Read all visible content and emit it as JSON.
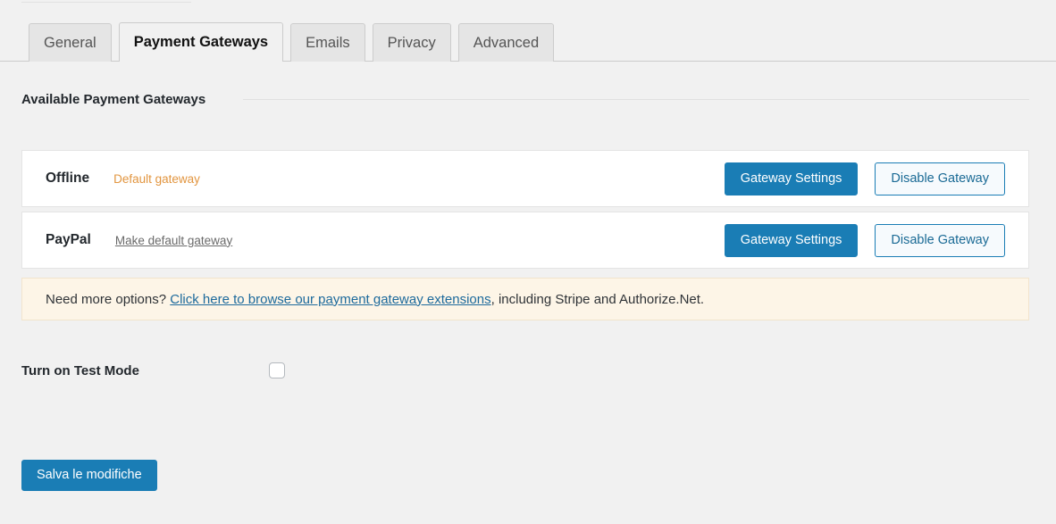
{
  "tabs": [
    {
      "label": "General",
      "active": false
    },
    {
      "label": "Payment Gateways",
      "active": true
    },
    {
      "label": "Emails",
      "active": false
    },
    {
      "label": "Privacy",
      "active": false
    },
    {
      "label": "Advanced",
      "active": false
    }
  ],
  "section": {
    "heading": "Available Payment Gateways"
  },
  "gateways": [
    {
      "name": "Offline",
      "status_text": "Default gateway",
      "status_type": "default",
      "settings_label": "Gateway Settings",
      "toggle_label": "Disable Gateway"
    },
    {
      "name": "PayPal",
      "status_text": "Make default gateway",
      "status_type": "link",
      "settings_label": "Gateway Settings",
      "toggle_label": "Disable Gateway"
    }
  ],
  "notice": {
    "lead": "Need more options?",
    "link": "Click here to browse our payment gateway extensions",
    "tail": ", including Stripe and Authorize.Net."
  },
  "test_mode": {
    "label": "Turn on Test Mode",
    "checked": false
  },
  "submit": {
    "label": "Salva le modifiche"
  },
  "colors": {
    "page_background": "#f1f1f1",
    "primary_button": "#1a7db5",
    "default_gateway_text": "#e2953f",
    "notice_background": "#fdf5e7",
    "notice_border": "#f2e4cc",
    "link": "#1d6a9c",
    "card_background": "#ffffff",
    "card_border": "#e4e4e4"
  }
}
